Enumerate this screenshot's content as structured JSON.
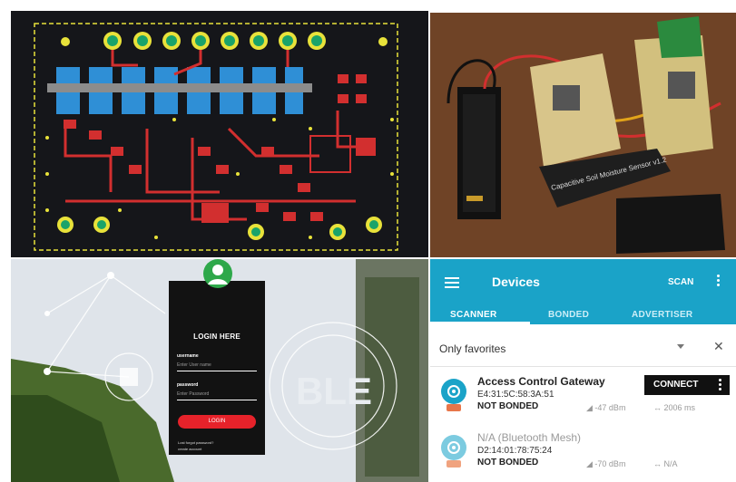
{
  "login": {
    "title": "LOGIN HERE",
    "username_label": "username",
    "username_placeholder": "Enter User name",
    "password_label": "password",
    "password_placeholder": "Enter Password",
    "button": "LOGIN",
    "forgot": "Lost forgot password?",
    "create": "create account"
  },
  "background": {
    "ble_text": "BLE"
  },
  "photo": {
    "board_text": "Capacitive Soil Moisture Sensor v1.2"
  },
  "app": {
    "title": "Devices",
    "scan": "SCAN",
    "tabs": [
      "SCANNER",
      "BONDED",
      "ADVERTISER"
    ],
    "filter": "Only favorites",
    "devices": [
      {
        "name": "Access Control Gateway",
        "mac": "E4:31:5C:58:3A:51",
        "bond": "NOT BONDED",
        "rssi": "-47 dBm",
        "interval": "↔ 2006 ms",
        "action": "CONNECT"
      },
      {
        "name": "N/A  (Bluetooth Mesh)",
        "mac": "D2:14:01:78:75:24",
        "bond": "NOT BONDED",
        "rssi": "-70 dBm",
        "interval": "↔ N/A"
      }
    ],
    "colors": {
      "bar": "#1aa3c8",
      "connect": "#111111"
    }
  },
  "icons": [
    "menu-icon",
    "kebab-icon",
    "close-icon",
    "chevron-down-icon",
    "bluetooth-device-icon",
    "signal-icon",
    "user-avatar-icon"
  ]
}
